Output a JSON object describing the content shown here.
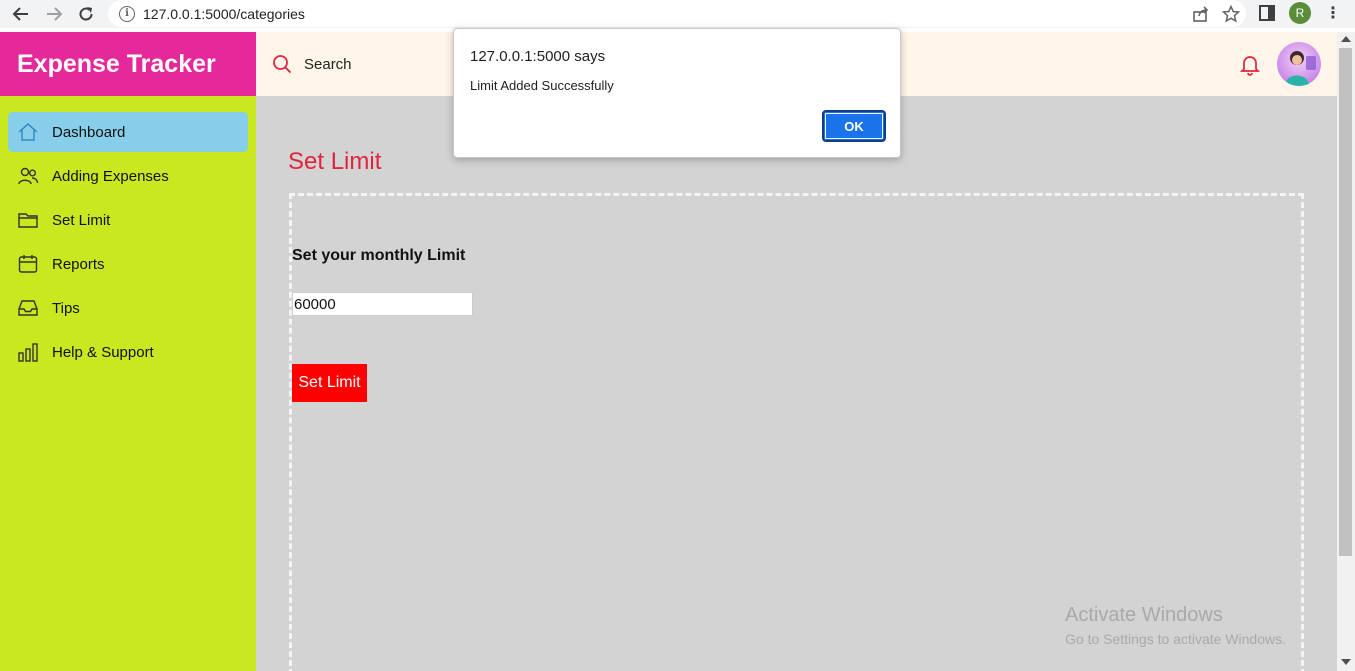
{
  "browser": {
    "url": "127.0.0.1:5000/categories",
    "profile_initial": "R"
  },
  "app": {
    "brand": "Expense Tracker",
    "brand_color": "#e5289a",
    "sidebar_color": "#c9e81f",
    "sidebar": {
      "items": [
        {
          "label": "Dashboard",
          "icon": "home-icon",
          "active": true
        },
        {
          "label": "Adding Expenses",
          "icon": "users-icon",
          "active": false
        },
        {
          "label": "Set Limit",
          "icon": "folder-icon",
          "active": false
        },
        {
          "label": "Reports",
          "icon": "calendar-icon",
          "active": false
        },
        {
          "label": "Tips",
          "icon": "inbox-icon",
          "active": false
        },
        {
          "label": "Help & Support",
          "icon": "bar-chart-icon",
          "active": false
        }
      ]
    },
    "topbar": {
      "search_label": "Search",
      "bell_icon": "bell-icon",
      "avatar_icon": "avatar-icon"
    },
    "main": {
      "title": "Set Limit",
      "heading": "Set your monthly Limit",
      "limit_value": "60000",
      "button_label": "Set Limit",
      "button_color": "#ff0000",
      "title_color": "#e0243e"
    }
  },
  "dialog": {
    "title": "127.0.0.1:5000 says",
    "message": "Limit Added Successfully",
    "ok_label": "OK"
  },
  "watermark": {
    "title": "Activate Windows",
    "subtitle": "Go to Settings to activate Windows."
  }
}
